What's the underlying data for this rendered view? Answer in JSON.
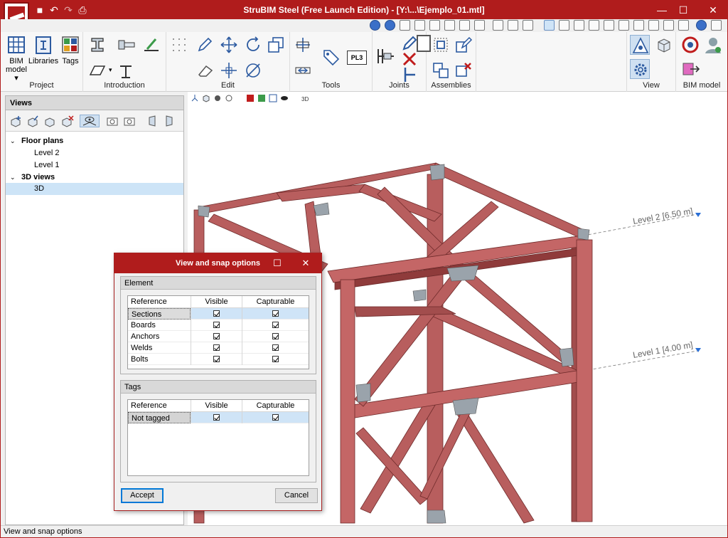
{
  "window": {
    "title": "StruBIM Steel (Free Launch Edition) - [Y:\\...\\Ejemplo_01.mtl]",
    "minimize_glyph": "—",
    "maximize_glyph": "☐",
    "close_glyph": "✕"
  },
  "ribbon": {
    "groups": [
      {
        "label": "Project"
      },
      {
        "label": "Introduction"
      },
      {
        "label": "Edit"
      },
      {
        "label": "Tools"
      },
      {
        "label": "Joints"
      },
      {
        "label": "Assemblies"
      },
      {
        "label": "View"
      },
      {
        "label": "BIM model"
      }
    ],
    "bim_model_label": "BIM\nmodel",
    "bim_model_l1": "BIM",
    "bim_model_l2": "model",
    "libraries_label": "Libraries",
    "tags_label": "Tags",
    "pl3_label": "PL3"
  },
  "views_panel": {
    "header": "Views",
    "tree": [
      {
        "label": "Floor plans",
        "type": "group"
      },
      {
        "label": "Level 2",
        "type": "item"
      },
      {
        "label": "Level 1",
        "type": "item"
      },
      {
        "label": "3D views",
        "type": "group"
      },
      {
        "label": "3D",
        "type": "item",
        "selected": true
      }
    ]
  },
  "viewport": {
    "level2": "Level 2 [6.50 m]",
    "level1": "Level 1 [4.00 m]",
    "beam_color": "#b85e5e",
    "beam_dark": "#8f3b3b",
    "plate_color": "#9aa3ab"
  },
  "dialog": {
    "title": "View and snap options",
    "element": {
      "title": "Element",
      "headers": {
        "reference": "Reference",
        "visible": "Visible",
        "capturable": "Capturable"
      },
      "rows": [
        {
          "reference": "Sections",
          "visible": true,
          "capturable": true
        },
        {
          "reference": "Boards",
          "visible": true,
          "capturable": true
        },
        {
          "reference": "Anchors",
          "visible": true,
          "capturable": true
        },
        {
          "reference": "Welds",
          "visible": true,
          "capturable": true
        },
        {
          "reference": "Bolts",
          "visible": true,
          "capturable": true
        }
      ]
    },
    "tags": {
      "title": "Tags",
      "headers": {
        "reference": "Reference",
        "visible": "Visible",
        "capturable": "Capturable"
      },
      "rows": [
        {
          "reference": "Not tagged",
          "visible": true,
          "capturable": true
        }
      ]
    },
    "accept_label": "Accept",
    "cancel_label": "Cancel"
  },
  "statusbar": {
    "text": "View and snap options"
  },
  "colors": {
    "title_bar": "#b01c1c",
    "selection": "#cde4f7",
    "accent": "#0078d7"
  }
}
